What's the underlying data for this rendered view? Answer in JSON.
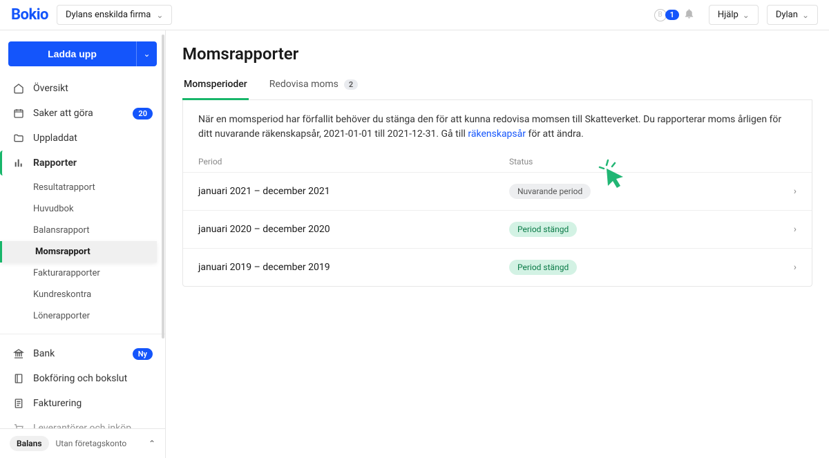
{
  "brand": "Bokio",
  "company": "Dylans enskilda firma",
  "notification_count": "1",
  "header": {
    "help": "Hjälp",
    "user": "Dylan"
  },
  "sidebar": {
    "upload": "Ladda upp",
    "items": {
      "overview": "Översikt",
      "todo": "Saker att göra",
      "todo_count": "20",
      "uploaded": "Uppladdat",
      "reports": "Rapporter",
      "bank": "Bank",
      "bank_badge": "Ny",
      "bookkeeping": "Bokföring och bokslut",
      "invoicing": "Fakturering",
      "suppliers": "Leverantörer och inköp"
    },
    "sub": {
      "result": "Resultatrapport",
      "ledger": "Huvudbok",
      "balance": "Balansrapport",
      "vat": "Momsrapport",
      "invoices": "Fakturarapporter",
      "receivables": "Kundreskontra",
      "payroll": "Lönerapporter"
    },
    "footer": {
      "plan": "Balans",
      "desc": "Utan företagskonto"
    }
  },
  "main": {
    "title": "Momsrapporter",
    "tabs": {
      "periods": "Momsperioder",
      "report": "Redovisa moms",
      "report_count": "2"
    },
    "info_prefix": "När en momsperiod har förfallit behöver du stänga den för att kunna redovisa momsen till Skatteverket. Du rapporterar moms årligen för ditt nuvarande räkenskapsår, 2021-01-01 till 2021-12-31. Gå till ",
    "info_link": "räkenskapsår",
    "info_suffix": " för att ändra.",
    "cols": {
      "period": "Period",
      "status": "Status"
    },
    "rows": [
      {
        "period": "januari 2021 – december 2021",
        "status": "Nuvarande period",
        "status_class": "grey"
      },
      {
        "period": "januari 2020 – december 2020",
        "status": "Period stängd",
        "status_class": "green"
      },
      {
        "period": "januari 2019 – december 2019",
        "status": "Period stängd",
        "status_class": "green"
      }
    ]
  }
}
